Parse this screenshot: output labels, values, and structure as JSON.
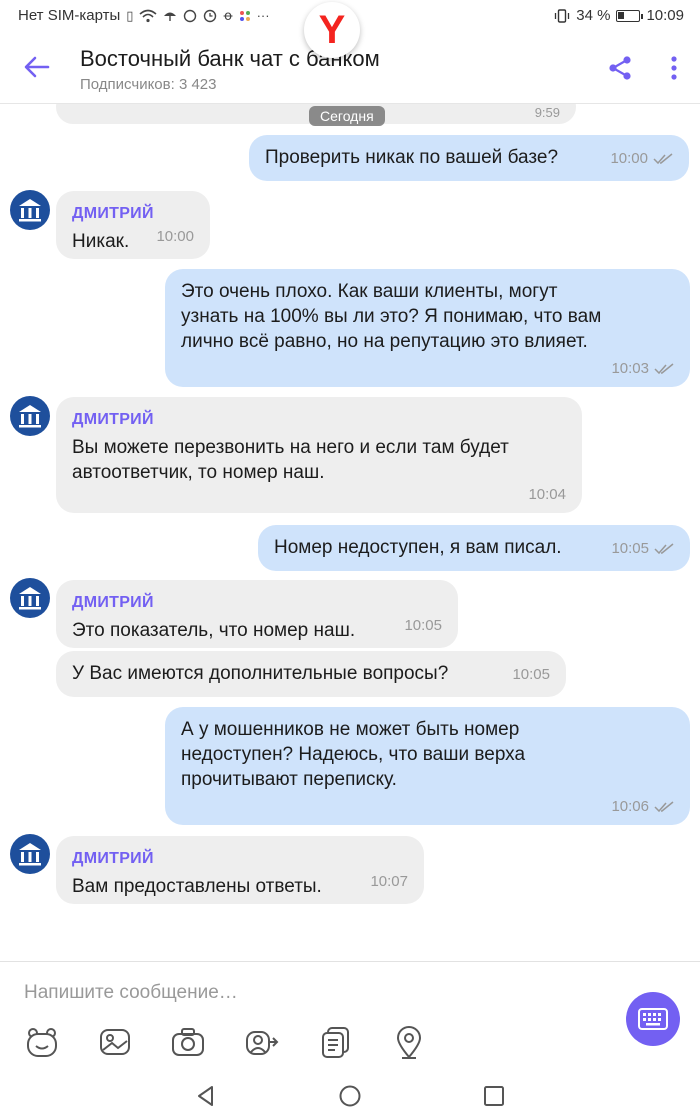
{
  "status_bar": {
    "carrier": "Нет SIM-карты",
    "battery": "34 %",
    "battery_level": 0.34,
    "time": "10:09"
  },
  "header": {
    "title": "Восточный банк  чат с банком",
    "subscribers": "Подписчиков: 3 423"
  },
  "chat": {
    "previous_time": "9:59",
    "date_label": "Сегодня",
    "messages": [
      {
        "dir": "out",
        "text": "Проверить никак по вашей базе?",
        "time": "10:00"
      },
      {
        "dir": "in",
        "sender": "ДМИТРИЙ",
        "text": "Никак.",
        "time": "10:00"
      },
      {
        "dir": "out",
        "text": "Это очень плохо. Как ваши клиенты, могут\nузнать на 100% вы ли это? Я понимаю, что вам\nлично всё равно, но  на репутацию это влияет.",
        "time": "10:03"
      },
      {
        "dir": "in",
        "sender": "ДМИТРИЙ",
        "text": "Вы можете перезвонить на него и если там будет\nавтоответчик, то номер наш.",
        "time": "10:04"
      },
      {
        "dir": "out",
        "text": "Номер недоступен, я вам писал.",
        "time": "10:05"
      },
      {
        "dir": "in",
        "sender": "ДМИТРИЙ",
        "text": "Это показатель, что номер наш.",
        "time": "10:05"
      },
      {
        "dir": "in",
        "text": "У Вас имеются дополнительные вопросы?",
        "time": "10:05"
      },
      {
        "dir": "out",
        "text": "А у мошенников не может быть номер\nнедоступен? Надеюсь, что ваши верха\nпрочитывают переписку.",
        "time": "10:06"
      },
      {
        "dir": "in",
        "sender": "ДМИТРИЙ",
        "text": "Вам предоставлены ответы.",
        "time": "10:07"
      }
    ]
  },
  "composer": {
    "placeholder": "Напишите сообщение…"
  },
  "colors": {
    "accent": "#7360f2",
    "outgoing_bubble": "#cfe3fb",
    "incoming_bubble": "#eeeeee",
    "avatar": "#1e4f9c"
  }
}
